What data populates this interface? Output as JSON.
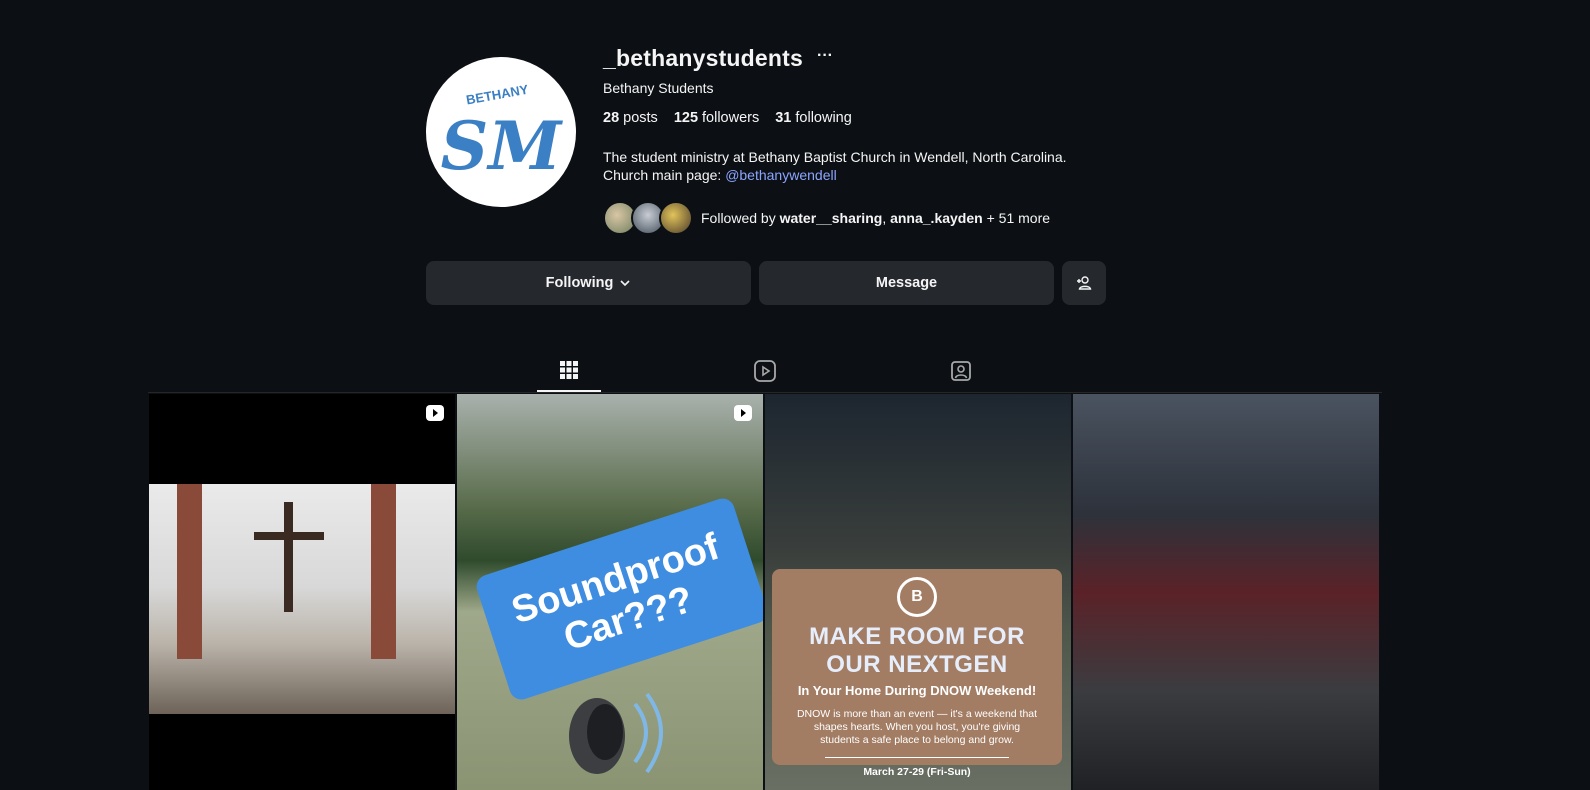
{
  "profile": {
    "username": "_bethanystudents",
    "full_name": "Bethany Students",
    "avatar_text_top": "BETHANY",
    "avatar_text_main": "SM",
    "stats": {
      "posts_count": "28",
      "posts_label": "posts",
      "followers_count": "125",
      "followers_label": "followers",
      "following_count": "31",
      "following_label": "following"
    },
    "bio_line1": "The student ministry at Bethany Baptist Church in Wendell, North Carolina.",
    "bio_line2_prefix": "Church main page: ",
    "bio_mention": "@bethanywendell",
    "followed_by_prefix": "Followed by ",
    "followed_by_user1": "water__sharing",
    "followed_by_sep": ", ",
    "followed_by_user2": "anna_.kayden",
    "followed_by_suffix": " + 51 more"
  },
  "actions": {
    "following_label": "Following",
    "message_label": "Message"
  },
  "posts": {
    "post2_text_line1": "Soundproof",
    "post2_text_line2": "Car???",
    "post3_logo": "B",
    "post3_title_line1": "MAKE ROOM FOR",
    "post3_title_line2": "OUR NEXTGEN",
    "post3_subtitle": "In Your Home During DNOW Weekend!",
    "post3_body": "DNOW is more than an event — it's a weekend that shapes hearts. When you host, you're giving students a safe place to belong and grow.",
    "post3_date": "March 27-29 (Fri-Sun)"
  },
  "colors": {
    "background": "#0c1014",
    "button_bg": "#25292e",
    "mention": "#8ba5ff",
    "avatar_brand_blue": "#3b7fc4"
  },
  "icons": [
    "more-icon",
    "chevron-down-icon",
    "add-user-icon",
    "grid-icon",
    "reels-icon",
    "tagged-icon",
    "reel-badge-icon"
  ]
}
